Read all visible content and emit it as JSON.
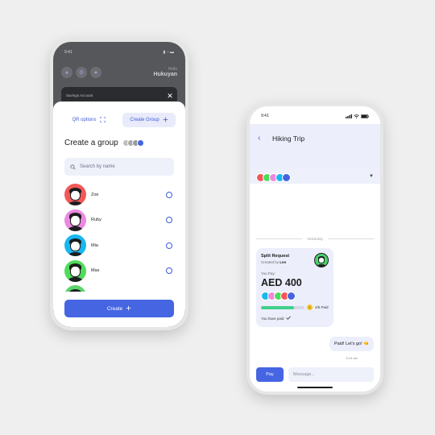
{
  "left_phone": {
    "status_time": "9:41",
    "background": {
      "user_label": "Hello",
      "user_name": "Hukuyan",
      "card_label": "Savings Account",
      "close_icon": "close-icon"
    },
    "sheet": {
      "qr_button_label": "QR options",
      "create_group_button_label": "Create Group",
      "title": "Create a group",
      "search_placeholder": "Search by name",
      "contacts": [
        {
          "name": "Zoe",
          "color": "#f35757"
        },
        {
          "name": "Ruby",
          "color": "#ec88e0"
        },
        {
          "name": "Mia",
          "color": "#18b7f1"
        },
        {
          "name": "Max",
          "color": "#4fdc5a"
        },
        {
          "name": "",
          "color": "#5bd46a"
        }
      ],
      "create_button_label": "Create"
    }
  },
  "right_phone": {
    "status_time": "9:41",
    "chat_title": "Hiking Trip",
    "divider_label": "Yesterday",
    "split_card": {
      "title": "Split Request",
      "created_by_prefix": "Created by",
      "created_by_name": "Leo",
      "you_pay_label": "You Pay:",
      "amount": "AED 400",
      "progress_fraction": 0.75,
      "paid_count": "4/5 Paid",
      "you_have_paid": "You have paid"
    },
    "message": {
      "text": "Paid! Let's go! 🤜",
      "time": "8:34 am"
    },
    "input": {
      "pay_button_label": "Pay",
      "placeholder": "Message..."
    }
  },
  "colors": {
    "accent": "#4565e3",
    "header_tint": "#eceefb",
    "progress": "#3fd08a"
  }
}
